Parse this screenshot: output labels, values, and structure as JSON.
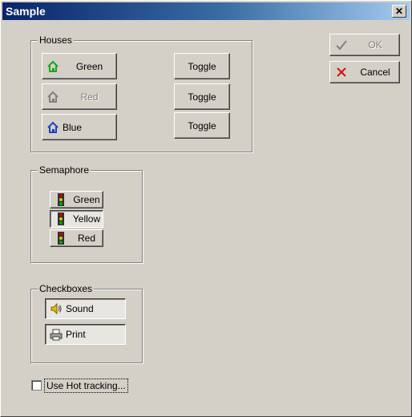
{
  "window": {
    "title": "Sample",
    "close_glyph": "✕"
  },
  "buttons": {
    "ok_label": "OK",
    "cancel_label": "Cancel"
  },
  "houses": {
    "legend": "Houses",
    "items": [
      {
        "label": "Green",
        "icon": "house-green-icon",
        "color": "#1aa51a",
        "enabled": true
      },
      {
        "label": "Red",
        "icon": "house-gray-icon",
        "color": "#808080",
        "enabled": false
      },
      {
        "label": "Blue",
        "icon": "house-blue-icon",
        "color": "#2040c0",
        "enabled": true
      }
    ],
    "toggle_label": "Toggle"
  },
  "semaphore": {
    "legend": "Semaphore",
    "items": [
      {
        "label": "Green",
        "icon": "traffic-light-icon",
        "selected": false
      },
      {
        "label": "Yellow",
        "icon": "traffic-light-icon",
        "selected": true
      },
      {
        "label": "Red",
        "icon": "traffic-light-icon",
        "selected": false
      }
    ]
  },
  "checkboxes": {
    "legend": "Checkboxes",
    "items": [
      {
        "label": "Sound",
        "icon": "speaker-icon",
        "checked": true
      },
      {
        "label": "Print",
        "icon": "printer-icon",
        "checked": true
      }
    ]
  },
  "hot_tracking": {
    "label": "Use Hot tracking...",
    "checked": false
  }
}
